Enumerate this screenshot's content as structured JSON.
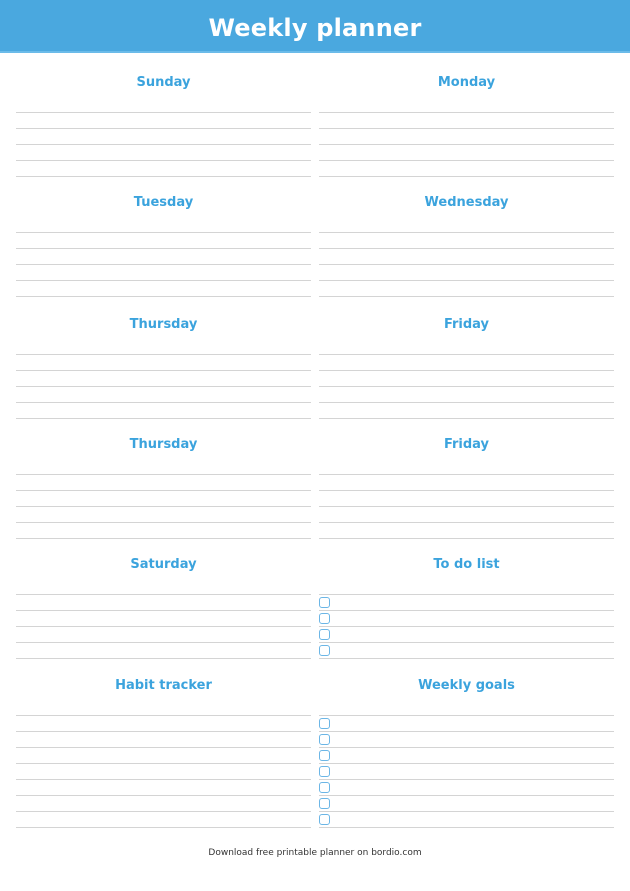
{
  "header": {
    "title": "Weekly planner"
  },
  "sections": [
    {
      "id": "sunday",
      "title": "Sunday",
      "column": "left",
      "row": 0,
      "lines": 5,
      "checkboxes": 0
    },
    {
      "id": "monday",
      "title": "Monday",
      "column": "right",
      "row": 0,
      "lines": 5,
      "checkboxes": 0
    },
    {
      "id": "tuesday",
      "title": "Tuesday",
      "column": "left",
      "row": 1,
      "lines": 5,
      "checkboxes": 0
    },
    {
      "id": "wednesday",
      "title": "Wednesday",
      "column": "right",
      "row": 1,
      "lines": 5,
      "checkboxes": 0
    },
    {
      "id": "thursday-1",
      "title": "Thursday",
      "column": "left",
      "row": 2,
      "lines": 5,
      "checkboxes": 0
    },
    {
      "id": "friday-1",
      "title": "Friday",
      "column": "right",
      "row": 2,
      "lines": 5,
      "checkboxes": 0
    },
    {
      "id": "thursday-2",
      "title": "Thursday",
      "column": "left",
      "row": 3,
      "lines": 5,
      "checkboxes": 0
    },
    {
      "id": "friday-2",
      "title": "Friday",
      "column": "right",
      "row": 3,
      "lines": 5,
      "checkboxes": 0
    },
    {
      "id": "saturday",
      "title": "Saturday",
      "column": "left",
      "row": 4,
      "lines": 5,
      "checkboxes": 0
    },
    {
      "id": "to-do-list",
      "title": "To do list",
      "column": "right",
      "row": 4,
      "lines": 5,
      "checkboxes": 4
    },
    {
      "id": "habit-tracker",
      "title": "Habit tracker",
      "column": "left",
      "row": 5,
      "lines": 8,
      "checkboxes": 0
    },
    {
      "id": "weekly-goals",
      "title": "Weekly goals",
      "column": "right",
      "row": 5,
      "lines": 8,
      "checkboxes": 7
    }
  ],
  "footer": {
    "text": "Download free printable planner on bordio.com"
  }
}
